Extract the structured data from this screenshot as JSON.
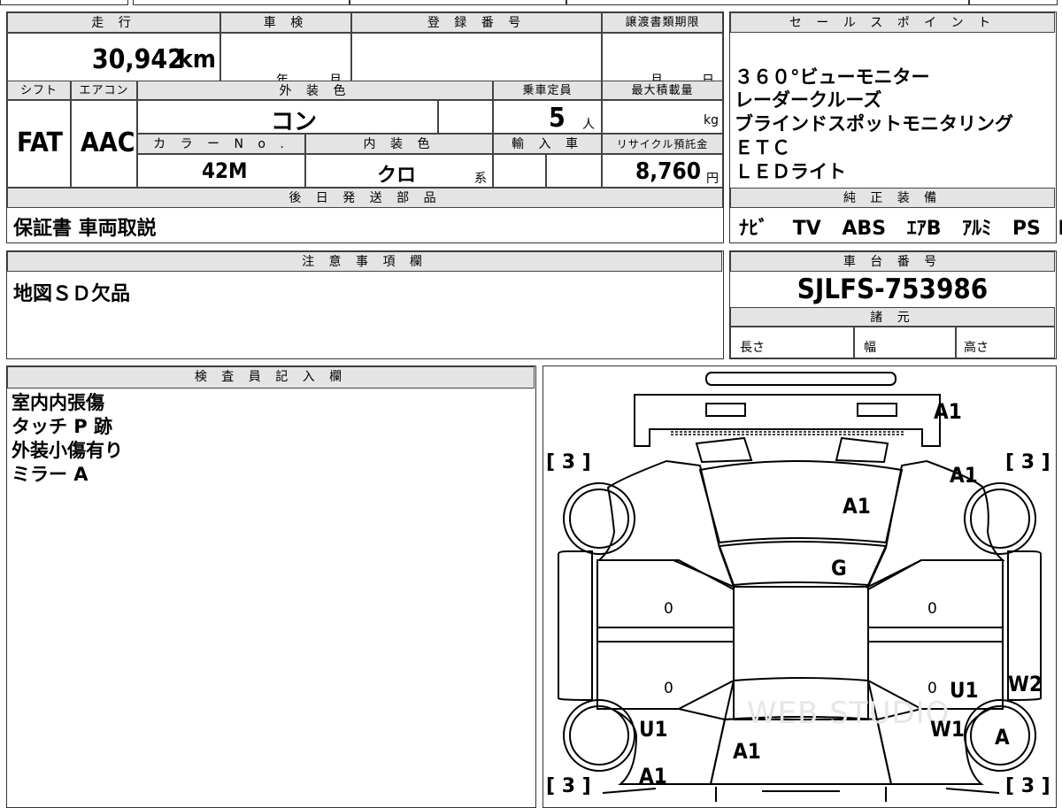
{
  "top": {
    "mileage_header": "走 行",
    "mileage": "30,942",
    "mileage_unit": "km",
    "inspection_header": "車 検",
    "inspection_year_unit": "年",
    "inspection_month_unit": "月",
    "registration_header": "登 録 番 号",
    "registration_value": "",
    "transfer_header": "譲渡書類期限",
    "transfer_month_unit": "月",
    "transfer_day_unit": "日",
    "shift_header": "シフト",
    "shift_value": "FAT",
    "ac_header": "エアコン",
    "ac_value": "AAC",
    "exterior_color_header": "外 装 色",
    "exterior_color_value": "コン",
    "capacity_header": "乗車定員",
    "capacity_value": "5",
    "capacity_unit": "人",
    "max_load_header": "最大積載量",
    "max_load_unit": "kg",
    "color_no_header": "カ ラ ー N o .",
    "color_no_value": "42M",
    "interior_color_header": "内 装 色",
    "interior_color_value": "クロ",
    "interior_color_suffix": "系",
    "import_header": "輸 入 車",
    "recycle_header": "リサイクル預託金",
    "recycle_value": "8,760",
    "recycle_unit": "円"
  },
  "later_parts": {
    "header": "後 日 発 送 部 品",
    "value": "保証書 車両取説"
  },
  "sales_points": {
    "header": "セ ー ル ス ポ イ ン ト",
    "items": [
      "３６０°ビューモニター",
      "レーダークルーズ",
      "ブラインドスポットモニタリング",
      "ＥＴＣ",
      "ＬＥＤライト"
    ]
  },
  "genuine_equipment": {
    "header": "純 正 装 備",
    "items": [
      "ﾅﾋﾞ",
      "TV",
      "ABS",
      "ｴｱB",
      "ｱﾙﾐ",
      "PS",
      "PW"
    ]
  },
  "notes": {
    "header": "注 意 事 項 欄",
    "value": "地図ＳＤ欠品"
  },
  "chassis": {
    "header": "車 台 番 号",
    "value": "SJLFS-753986",
    "specs_header": "諸 元",
    "length_label": "長さ",
    "width_label": "幅",
    "height_label": "高さ"
  },
  "inspector": {
    "header": "検 査 員 記 入 欄",
    "lines": [
      "室内内張傷",
      "タッチ P 跡",
      "外装小傷有り",
      "ミラー A"
    ]
  },
  "diagram": {
    "marks": {
      "front_bumper": "A1",
      "hood": "A1",
      "front_right_fender": "A1",
      "roof": "G",
      "front_left_door": "0",
      "rear_left_door": "0",
      "front_right_door": "0",
      "rear_right_door": "0",
      "right_rear_door_mark": "U1",
      "right_rocker": "W2",
      "left_rear_fender": "U1",
      "right_rear_fender": "W1",
      "right_rear_wheel": "A",
      "tailgate": "A1",
      "rear_left_corner": "A1"
    },
    "tread": {
      "front_left": "[ 3 ]",
      "front_right": "[ 3 ]",
      "rear_left": "[ 3 ]",
      "rear_right": "[ 3 ]"
    },
    "watermark": "WEB STUDIO"
  }
}
